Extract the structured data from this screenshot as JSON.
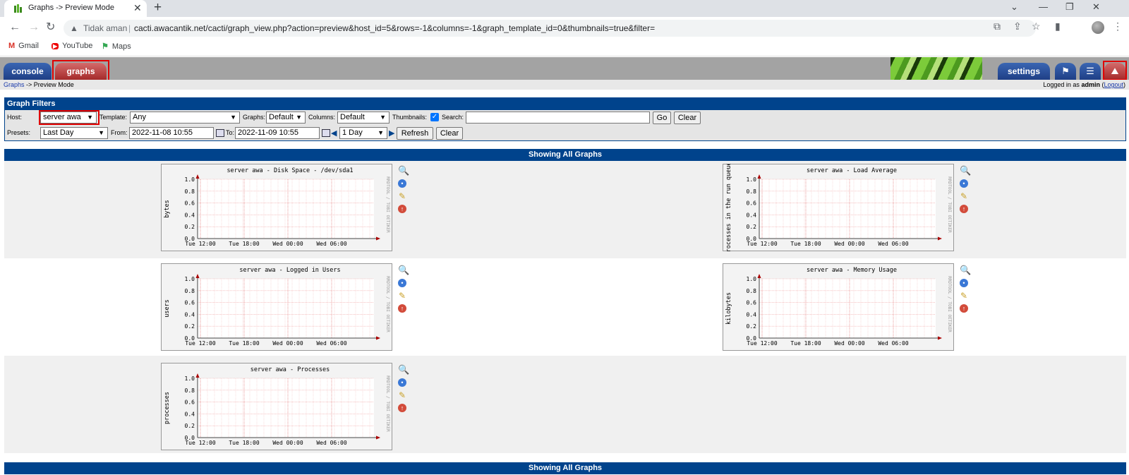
{
  "browser": {
    "tab_title": "Graphs -> Preview Mode",
    "security_label": "Tidak aman",
    "url": "cacti.awacantik.net/cacti/graph_view.php?action=preview&host_id=5&rows=-1&columns=-1&graph_template_id=0&thumbnails=true&filter=",
    "bookmarks": [
      {
        "label": "Gmail",
        "icon": "gmail-icon"
      },
      {
        "label": "YouTube",
        "icon": "youtube-icon"
      },
      {
        "label": "Maps",
        "icon": "maps-icon"
      }
    ]
  },
  "header": {
    "tabs": {
      "console": "console",
      "graphs": "graphs",
      "settings": "settings"
    },
    "breadcrumb_link": "Graphs",
    "breadcrumb_rest": "-> Preview Mode",
    "logged_in_prefix": "Logged in as",
    "user": "admin",
    "logout": "Logout"
  },
  "filters": {
    "title": "Graph Filters",
    "host_label": "Host:",
    "host_value": "server awa",
    "template_label": "Template:",
    "template_value": "Any",
    "graphs_label": "Graphs:",
    "graphs_value": "Default",
    "columns_label": "Columns:",
    "columns_value": "Default",
    "thumbnails_label": "Thumbnails:",
    "thumbnails_checked": true,
    "search_label": "Search:",
    "search_value": "",
    "go": "Go",
    "clear": "Clear",
    "presets_label": "Presets:",
    "presets_value": "Last Day",
    "from_label": "From:",
    "from_value": "2022-11-08 10:55",
    "to_label": "To:",
    "to_value": "2022-11-09 10:55",
    "shift_value": "1 Day",
    "refresh": "Refresh",
    "clear2": "Clear"
  },
  "showing_all": "Showing All Graphs",
  "graphs": [
    {
      "title": "server awa - Disk Space - /dev/sda1",
      "ylabel": "bytes"
    },
    {
      "title": "server awa - Load Average",
      "ylabel": "processes in the run queue"
    },
    {
      "title": "server awa - Logged in Users",
      "ylabel": "users"
    },
    {
      "title": "server awa - Memory Usage",
      "ylabel": "kilobytes"
    },
    {
      "title": "server awa - Processes",
      "ylabel": "processes"
    }
  ],
  "graph_axes": {
    "y_ticks": [
      "0.0",
      "0.2",
      "0.4",
      "0.6",
      "0.8",
      "1.0"
    ],
    "x_ticks": [
      "Tue 12:00",
      "Tue 18:00",
      "Wed 00:00",
      "Wed 06:00"
    ],
    "watermark": "RRDTOOL / TOBI OETIKER"
  }
}
